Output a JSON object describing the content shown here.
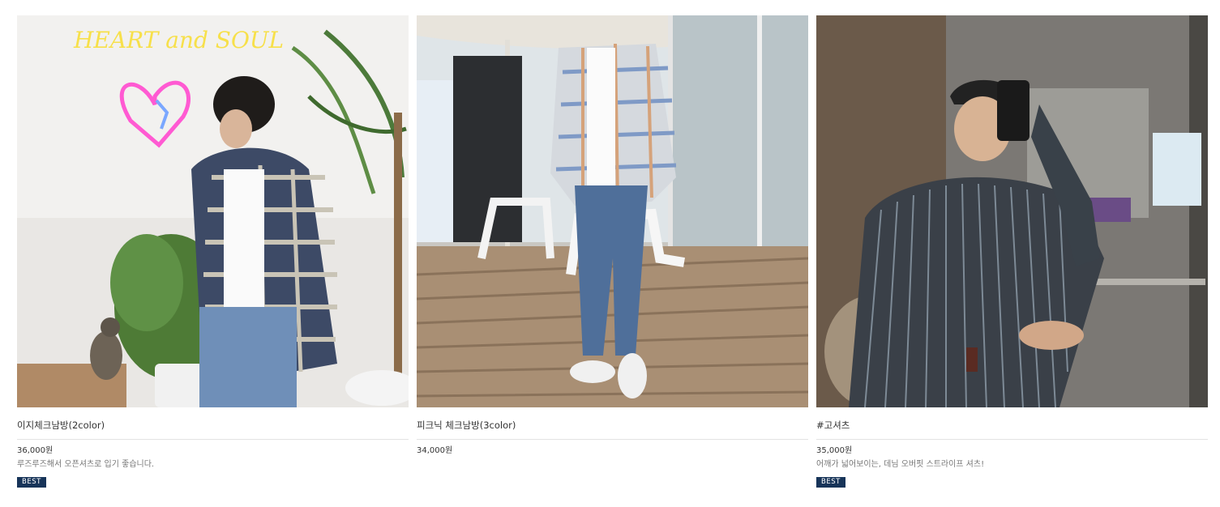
{
  "products": [
    {
      "name": "이지체크남방(2color)",
      "price": "36,000원",
      "summary": "루즈루즈해서 오픈셔츠로 입기 좋습니다.",
      "badge": "BEST",
      "image_icon": "product-photo-plaid-shirt-icon",
      "neon_text": "HEART and SOUL"
    },
    {
      "name": "피크닉 체크남방(3color)",
      "price": "34,000원",
      "image_icon": "product-photo-picnic-check-shirt-icon"
    },
    {
      "name": "#고셔츠",
      "price": "35,000원",
      "summary": "어깨가 넓어보이는, 데님 오버핏 스트라이프 셔츠!",
      "badge": "BEST",
      "image_icon": "product-photo-stripe-shirt-icon"
    }
  ],
  "colors": {
    "badge_bg": "#173459",
    "badge_text": "#ffffff",
    "name_text": "#333333",
    "summary_text": "#777777",
    "divider": "#e3e3e3"
  }
}
